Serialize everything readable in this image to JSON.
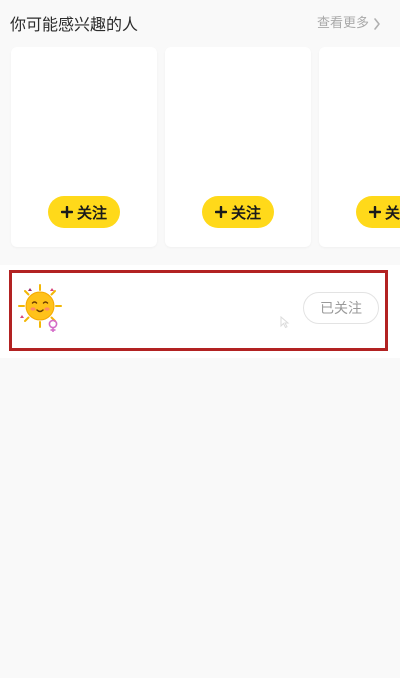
{
  "section": {
    "title": "你可能感兴趣的人",
    "see_more_label": "查看更多",
    "see_more_icon": "chevron-right-icon"
  },
  "recommendations": [
    {
      "follow_label": "关注",
      "icon": "plus-icon"
    },
    {
      "follow_label": "关注",
      "icon": "plus-icon"
    },
    {
      "follow_label": "关注",
      "icon": "plus-icon"
    }
  ],
  "followed_user": {
    "avatar_icon": "sun-avatar-icon",
    "gender_icon": "female-icon",
    "button_label": "已关注"
  },
  "colors": {
    "accent": "#ffd91a",
    "highlight_border": "#b22222",
    "background": "#f9f9f9",
    "card": "#ffffff",
    "muted_text": "#a9a9a9"
  }
}
